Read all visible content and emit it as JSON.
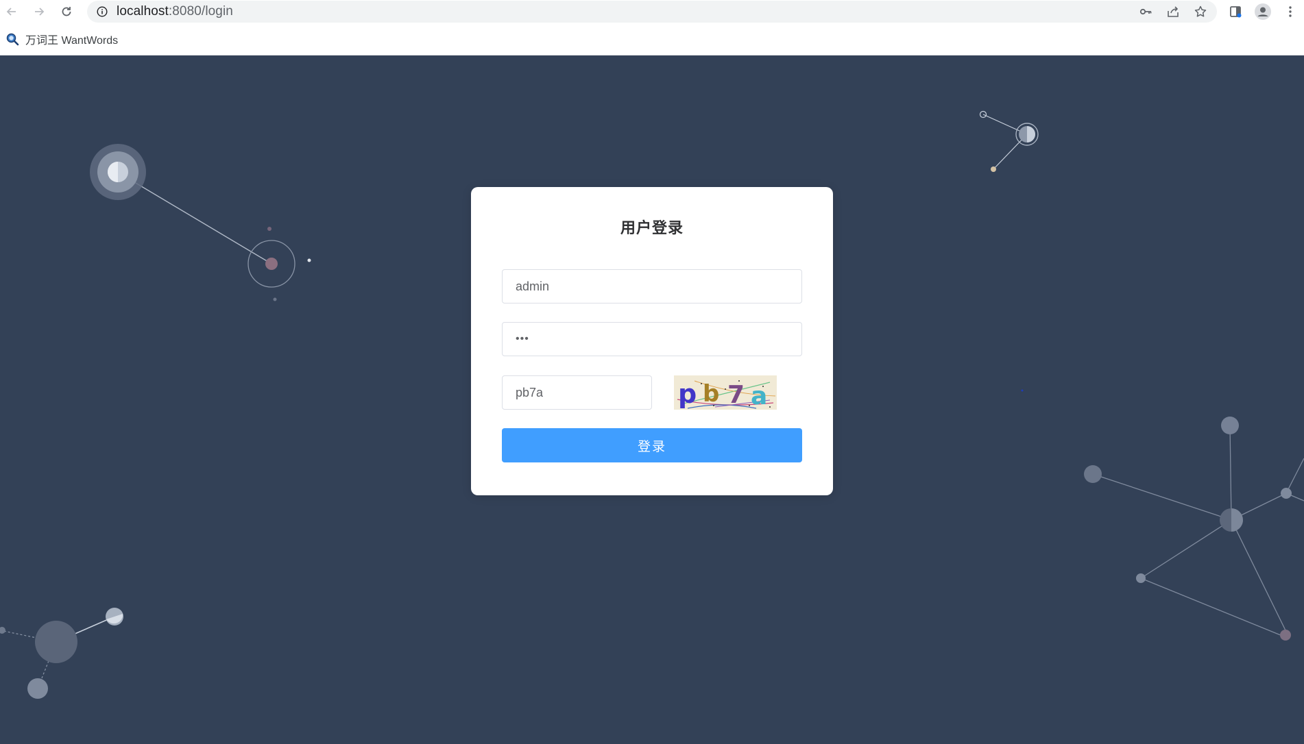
{
  "browser": {
    "url_host": "localhost",
    "url_path": ":8080/login",
    "bookmarks": [
      {
        "label": "万词王 WantWords",
        "icon": "search-favicon"
      }
    ]
  },
  "login": {
    "title": "用户登录",
    "username_value": "admin",
    "password_mask": "•••",
    "captcha_input_value": "pb7a",
    "captcha_image_text": [
      "p",
      "b",
      "7",
      "a"
    ],
    "submit_label": "登录"
  },
  "colors": {
    "page_background": "#334157",
    "primary_button": "#409eff",
    "card": "#ffffff"
  }
}
